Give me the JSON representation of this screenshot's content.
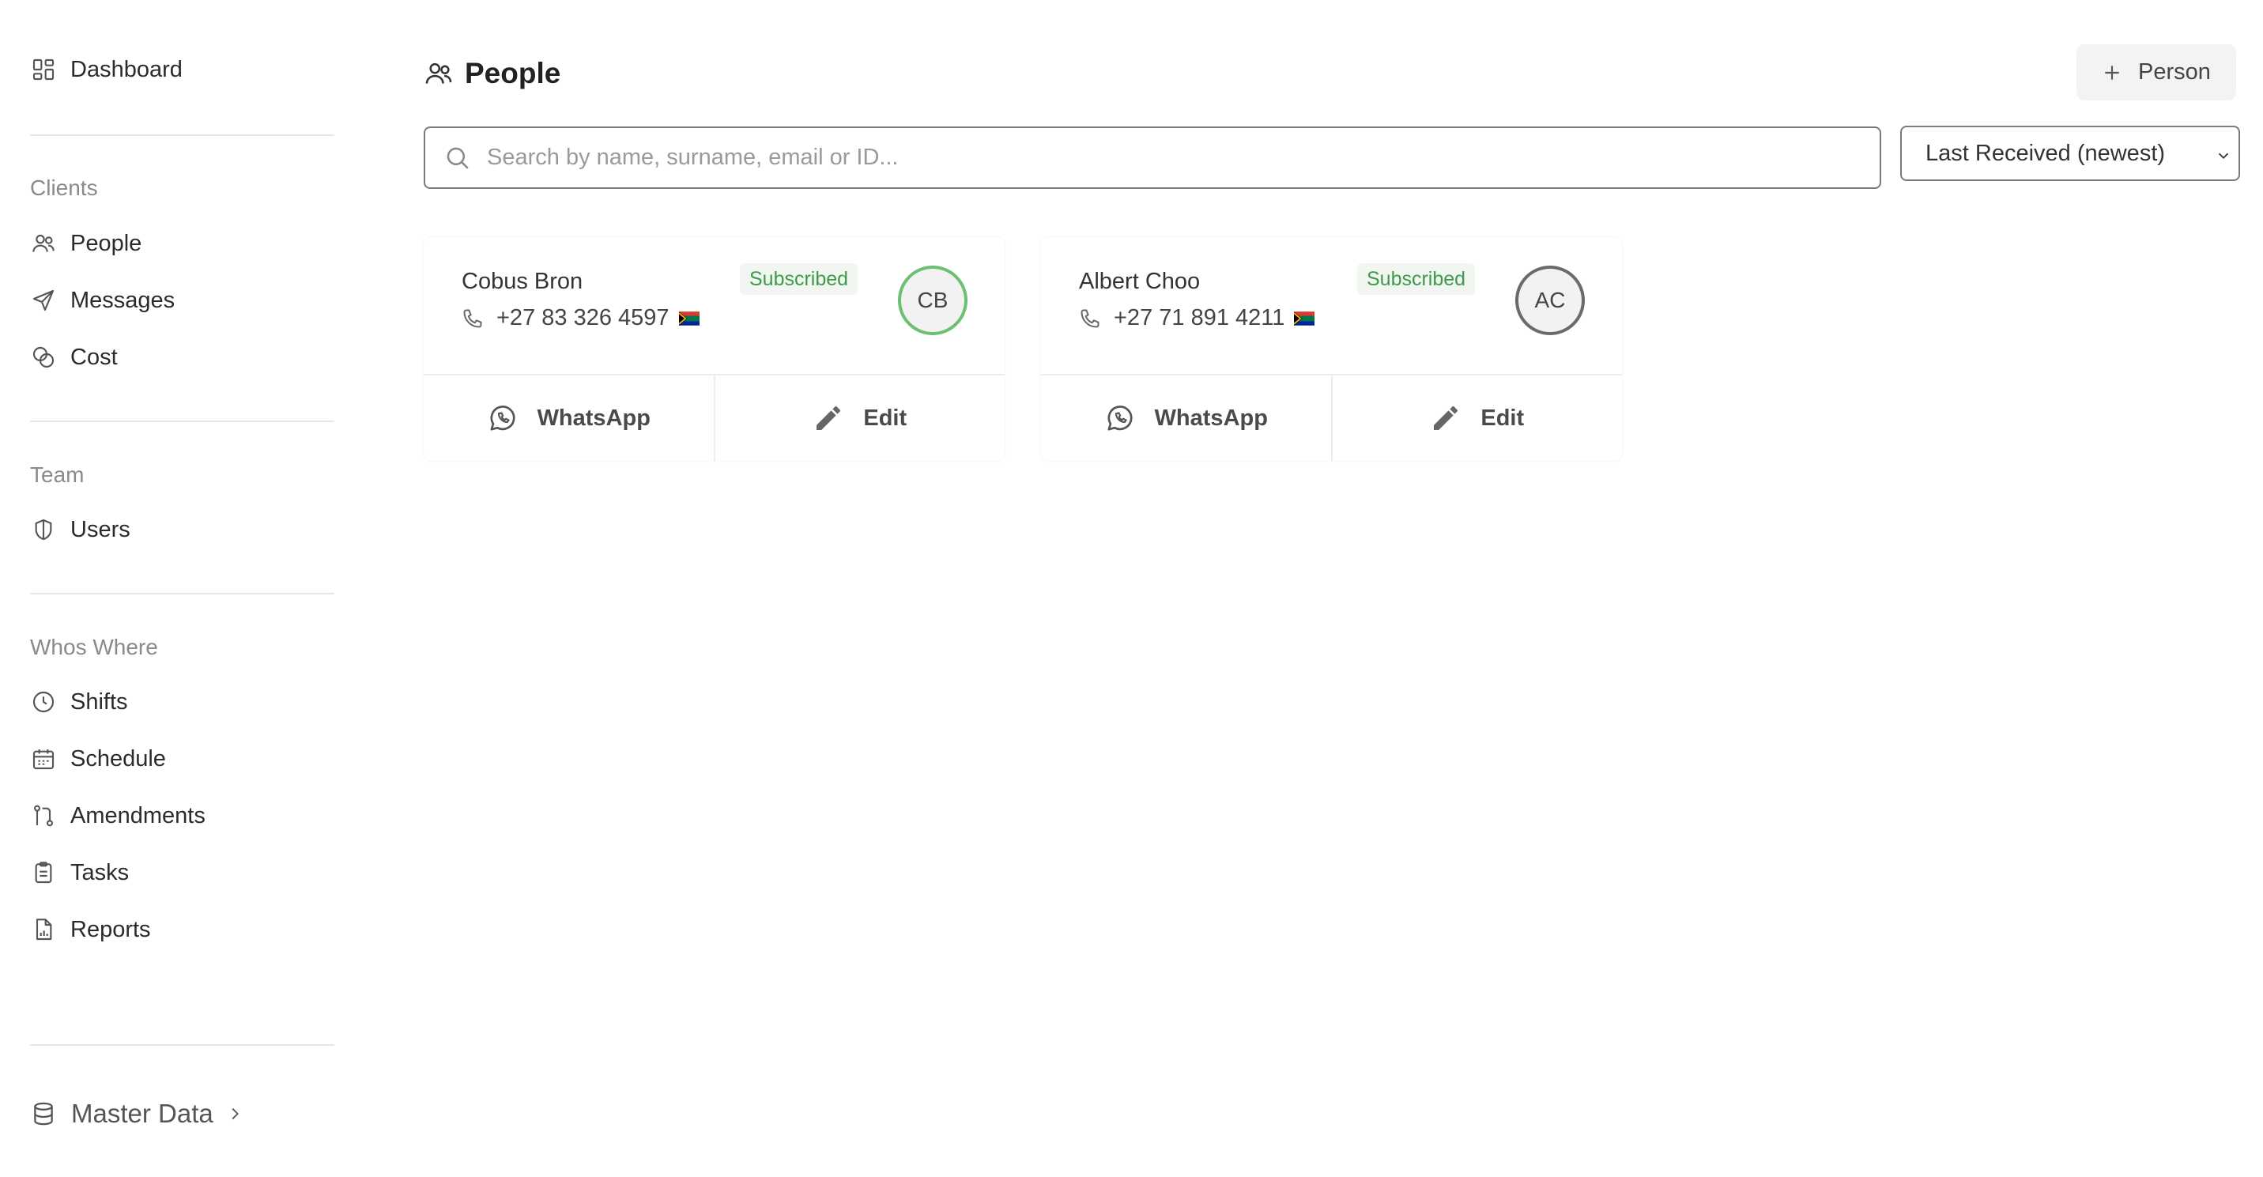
{
  "sidebar": {
    "dashboard": "Dashboard",
    "sections": {
      "clients": "Clients",
      "team": "Team",
      "whos_where": "Whos Where"
    },
    "items": {
      "people": "People",
      "messages": "Messages",
      "cost": "Cost",
      "users": "Users",
      "shifts": "Shifts",
      "schedule": "Schedule",
      "amendments": "Amendments",
      "tasks": "Tasks",
      "reports": "Reports"
    },
    "master_data": "Master Data"
  },
  "header": {
    "title": "People",
    "add_button": "Person"
  },
  "search": {
    "placeholder": "Search by name, surname, email or ID...",
    "value": ""
  },
  "sort": {
    "selected": "Last Received (newest)"
  },
  "people": [
    {
      "name": "Cobus Bron",
      "phone": "+27 83 326 4597",
      "status": "Subscribed",
      "initials": "CB",
      "whatsapp_label": "WhatsApp",
      "edit_label": "Edit"
    },
    {
      "name": "Albert Choo",
      "phone": "+27 71 891 4211",
      "status": "Subscribed",
      "initials": "AC",
      "whatsapp_label": "WhatsApp",
      "edit_label": "Edit"
    }
  ],
  "colors": {
    "subscribed_text": "#3d9a4b",
    "subscribed_bg": "#f1f6f1",
    "avatar_ring_active": "#6cbf73",
    "avatar_ring_default": "#6a6a6a"
  },
  "icons": {
    "dashboard": "grid-icon",
    "people": "users-icon",
    "messages": "send-icon",
    "cost": "coins-icon",
    "users": "shield-icon",
    "shifts": "clock-icon",
    "schedule": "calendar-icon",
    "amendments": "git-pull-request-icon",
    "tasks": "clipboard-icon",
    "reports": "file-chart-icon",
    "master_data": "database-icon"
  }
}
